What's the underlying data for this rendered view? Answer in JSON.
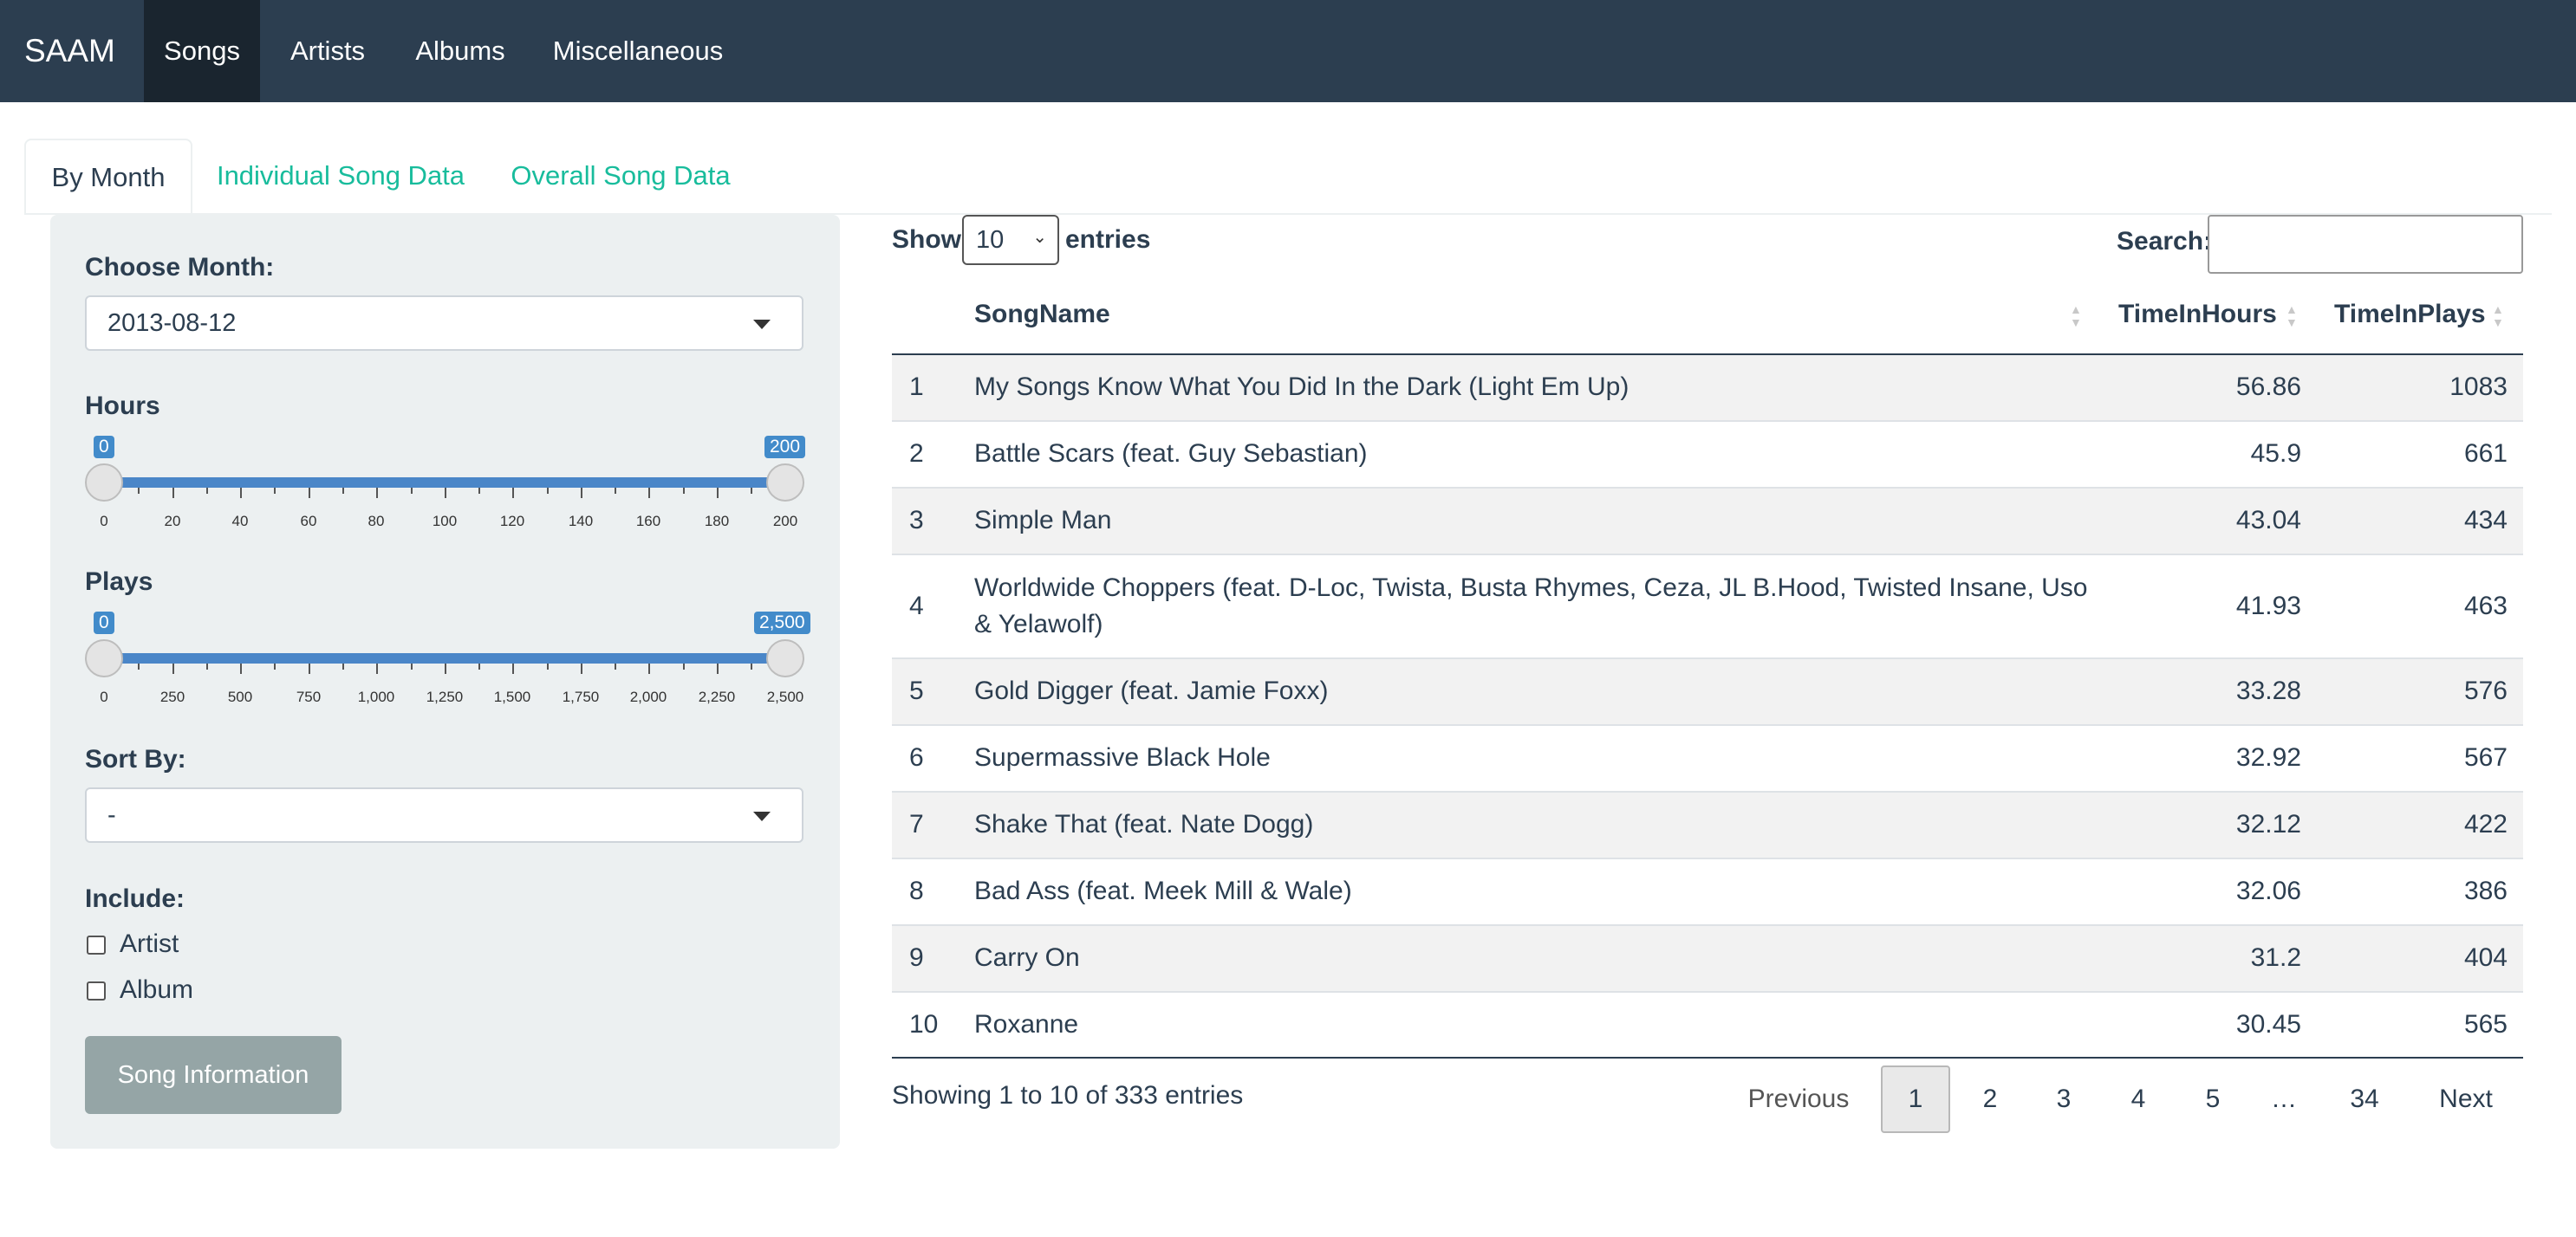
{
  "navbar": {
    "brand": "SAAM",
    "items": [
      {
        "label": "Songs",
        "active": true
      },
      {
        "label": "Artists",
        "active": false
      },
      {
        "label": "Albums",
        "active": false
      },
      {
        "label": "Miscellaneous",
        "active": false
      }
    ]
  },
  "tabs": [
    {
      "label": "By Month",
      "active": true
    },
    {
      "label": "Individual Song Data",
      "active": false
    },
    {
      "label": "Overall Song Data",
      "active": false
    }
  ],
  "sidebar": {
    "month_label": "Choose Month:",
    "month_value": "2013-08-12",
    "hours": {
      "label": "Hours",
      "min": 0,
      "max": 200,
      "from": 0,
      "to": 200,
      "from_label": "0",
      "to_label": "200",
      "ticks": [
        "0",
        "20",
        "40",
        "60",
        "80",
        "100",
        "120",
        "140",
        "160",
        "180",
        "200"
      ]
    },
    "plays": {
      "label": "Plays",
      "min": 0,
      "max": 2500,
      "from": 0,
      "to": 2500,
      "from_label": "0",
      "to_label": "2,500",
      "ticks": [
        "0",
        "250",
        "500",
        "750",
        "1,000",
        "1,250",
        "1,500",
        "1,750",
        "2,000",
        "2,250",
        "2,500"
      ]
    },
    "sort_label": "Sort By:",
    "sort_value": "-",
    "include_label": "Include:",
    "include_options": [
      {
        "label": "Artist",
        "checked": false
      },
      {
        "label": "Album",
        "checked": false
      }
    ],
    "button_label": "Song Information"
  },
  "table": {
    "show_label": "Show",
    "length_value": "10",
    "entries_label": "entries",
    "search_label": "Search:",
    "search_value": "",
    "columns": [
      "",
      "SongName",
      "TimeInHours",
      "TimeInPlays"
    ],
    "rows": [
      {
        "idx": "1",
        "name": "My Songs Know What You Did In the Dark (Light Em Up)",
        "hours": "56.86",
        "plays": "1083"
      },
      {
        "idx": "2",
        "name": "Battle Scars (feat. Guy Sebastian)",
        "hours": "45.9",
        "plays": "661"
      },
      {
        "idx": "3",
        "name": "Simple Man",
        "hours": "43.04",
        "plays": "434"
      },
      {
        "idx": "4",
        "name": "Worldwide Choppers (feat. D-Loc, Twista, Busta Rhymes, Ceza, JL B.Hood, Twisted Insane, Uso & Yelawolf)",
        "hours": "41.93",
        "plays": "463"
      },
      {
        "idx": "5",
        "name": "Gold Digger (feat. Jamie Foxx)",
        "hours": "33.28",
        "plays": "576"
      },
      {
        "idx": "6",
        "name": "Supermassive Black Hole",
        "hours": "32.92",
        "plays": "567"
      },
      {
        "idx": "7",
        "name": "Shake That (feat. Nate Dogg)",
        "hours": "32.12",
        "plays": "422"
      },
      {
        "idx": "8",
        "name": "Bad Ass (feat. Meek Mill & Wale)",
        "hours": "32.06",
        "plays": "386"
      },
      {
        "idx": "9",
        "name": "Carry On",
        "hours": "31.2",
        "plays": "404"
      },
      {
        "idx": "10",
        "name": "Roxanne",
        "hours": "30.45",
        "plays": "565"
      }
    ],
    "info": "Showing 1 to 10 of 333 entries",
    "pagination": {
      "previous": "Previous",
      "pages": [
        "1",
        "2",
        "3",
        "4",
        "5",
        "…",
        "34"
      ],
      "current": "1",
      "next": "Next"
    }
  }
}
